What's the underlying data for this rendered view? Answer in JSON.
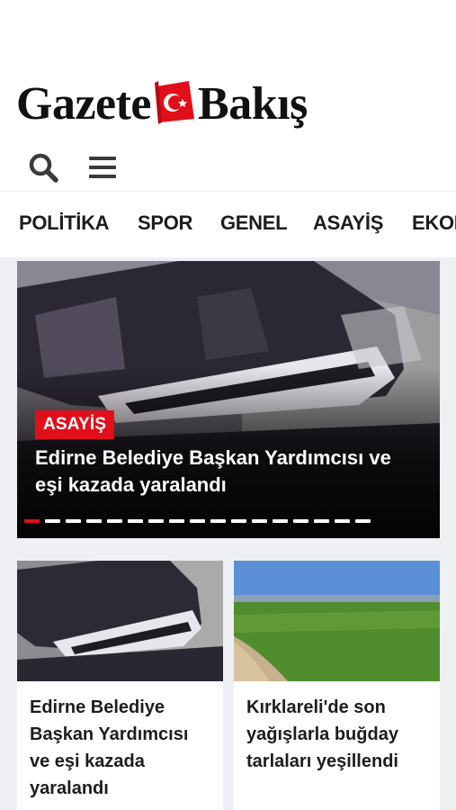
{
  "brand": {
    "name_left": "Gazete",
    "name_right": "Bakış",
    "flag_color": "#e10f1a",
    "flag_icon": "turkish-flag-icon"
  },
  "toolbar": {
    "search_icon": "search-icon",
    "menu_icon": "hamburger-menu-icon"
  },
  "nav": {
    "items": [
      "POLİTİKA",
      "SPOR",
      "GENEL",
      "ASAYİŞ",
      "EKONOMİ"
    ]
  },
  "hero": {
    "category": "ASAYİŞ",
    "title": "Edirne Belediye Başkan Yardımcısı ve eşi kazada yaralandı",
    "slide_count": 17,
    "active_slide": 1
  },
  "cards": [
    {
      "title": "Edirne Belediye Başkan Yardımcısı ve eşi kazada yaralandı"
    },
    {
      "title": "Kırklareli'de son yağışlarla buğday tarlaları yeşillendi"
    }
  ],
  "colors": {
    "accent": "#e10f1a",
    "page_bg": "#eef0f3",
    "text": "#1d1d1f"
  }
}
